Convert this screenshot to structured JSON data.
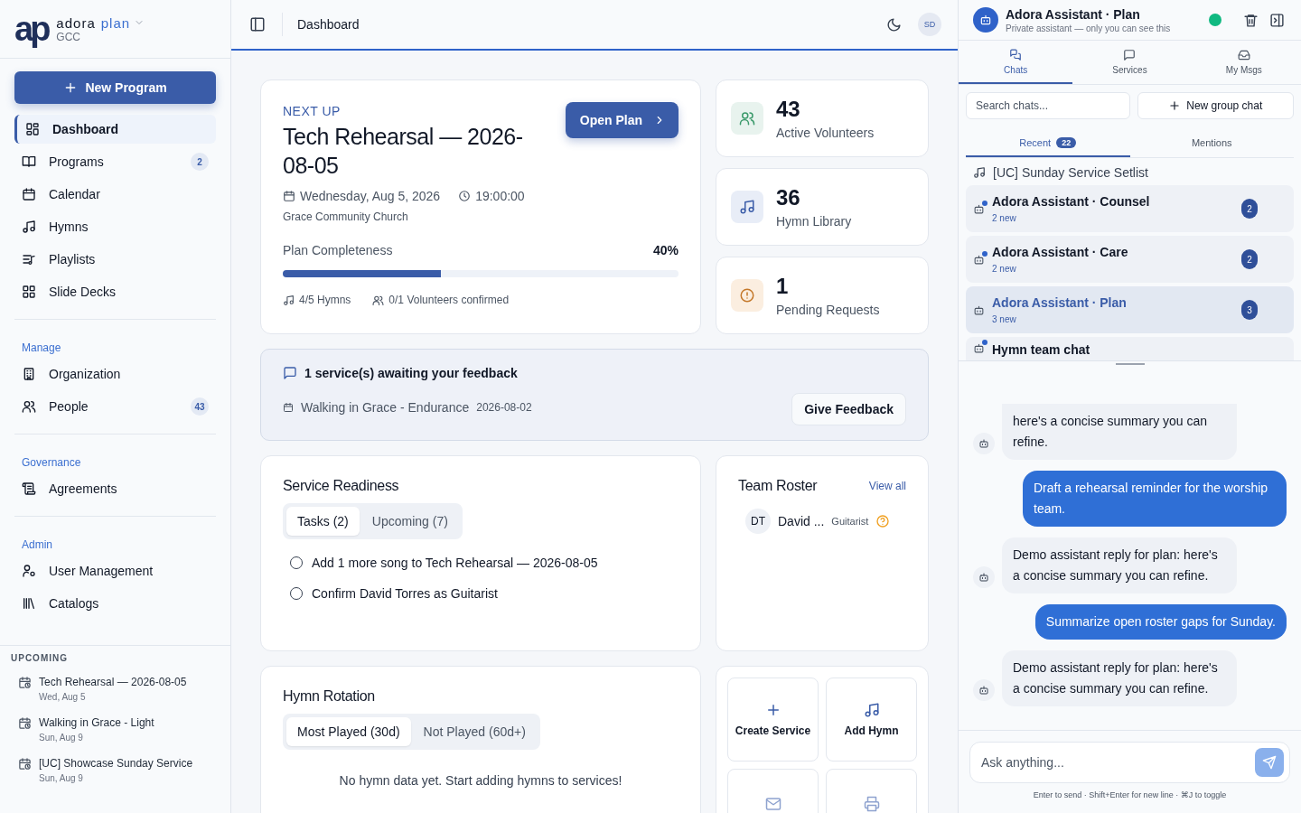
{
  "brand": {
    "logo": "ap",
    "name": "adora",
    "accent": "plan",
    "org": "GCC"
  },
  "new_program_button": "New Program",
  "nav": [
    {
      "kind": "dashboard",
      "label": "Dashboard",
      "selected": true
    },
    {
      "kind": "book",
      "label": "Programs",
      "badge": "2",
      "selected": false
    },
    {
      "kind": "calendar",
      "label": "Calendar",
      "selected": false
    },
    {
      "kind": "music",
      "label": "Hymns",
      "selected": false
    },
    {
      "kind": "playlist",
      "label": "Playlists",
      "selected": false
    },
    {
      "kind": "grid",
      "label": "Slide Decks",
      "selected": false
    }
  ],
  "nav_sections": [
    {
      "title": "Manage",
      "items": [
        {
          "kind": "building",
          "label": "Organization",
          "selected": false
        },
        {
          "kind": "people",
          "label": "People",
          "badge": "43",
          "selected": false
        }
      ]
    },
    {
      "title": "Governance",
      "items": [
        {
          "kind": "scroll",
          "label": "Agreements",
          "selected": false
        }
      ]
    },
    {
      "title": "Admin",
      "items": [
        {
          "kind": "user-gear",
          "label": "User Management",
          "selected": false
        },
        {
          "kind": "library",
          "label": "Catalogs",
          "selected": false
        }
      ]
    }
  ],
  "upcoming": {
    "title": "UPCOMING",
    "items": [
      {
        "title": "Tech Rehearsal — 2026-08-05",
        "date": "Wed, Aug 5"
      },
      {
        "title": "Walking in Grace - Light",
        "date": "Sun, Aug 9"
      },
      {
        "title": "[UC] Showcase Sunday Service",
        "date": "Sun, Aug 9"
      }
    ]
  },
  "topbar": {
    "title": "Dashboard",
    "avatar": "SD"
  },
  "next_up": {
    "eyebrow": "NEXT UP",
    "title": "Tech Rehearsal — 2026-08-05",
    "date": "Wednesday, Aug 5, 2026",
    "time": "19:00:00",
    "location": "Grace Community Church",
    "button": "Open Plan",
    "progress_label": "Plan Completeness",
    "progress_reading": "40%",
    "level": 0.4,
    "hymns": "4/5 Hymns",
    "volunteers": "0/1 Volunteers confirmed"
  },
  "stats": [
    {
      "kind": "volunteers",
      "value": "43",
      "label": "Active Volunteers"
    },
    {
      "kind": "hymns",
      "value": "36",
      "label": "Hymn Library"
    },
    {
      "kind": "requests",
      "value": "1",
      "label": "Pending Requests"
    }
  ],
  "feedback": {
    "title": "1 service(s) awaiting your feedback",
    "service": "Walking in Grace - Endurance",
    "date": "2026-08-02",
    "button": "Give Feedback"
  },
  "readiness": {
    "title": "Service Readiness",
    "tabs": [
      {
        "label": "Tasks (2)",
        "selected": true
      },
      {
        "label": "Upcoming (7)",
        "selected": false
      }
    ],
    "tasks": [
      {
        "text": "Add 1 more song to Tech Rehearsal — 2026-08-05",
        "checked": false
      },
      {
        "text": "Confirm David Torres as Guitarist",
        "checked": false
      }
    ]
  },
  "roster": {
    "title": "Team Roster",
    "link": "View all",
    "members": [
      {
        "initials": "DT",
        "name": "David ...",
        "role": "Guitarist",
        "confirmed": false
      }
    ]
  },
  "hymn_rotation": {
    "title": "Hymn Rotation",
    "tabs": [
      {
        "label": "Most Played (30d)",
        "selected": true
      },
      {
        "label": "Not Played (60d+)",
        "selected": false
      }
    ],
    "empty": "No hymn data yet. Start adding hymns to services!"
  },
  "quick_actions": [
    {
      "kind": "create",
      "label": "Create Service"
    },
    {
      "kind": "hymn",
      "label": "Add Hymn"
    },
    {
      "kind": "mail"
    },
    {
      "kind": "print"
    }
  ],
  "assistant": {
    "title": "Adora Assistant · Plan",
    "subtitle": "Private assistant — only you can see this",
    "online": true,
    "tabs": [
      {
        "kind": "chats",
        "label": "Chats",
        "selected": true
      },
      {
        "kind": "services",
        "label": "Services",
        "selected": false
      },
      {
        "kind": "inbox",
        "label": "My Msgs",
        "selected": false
      }
    ],
    "search_placeholder": "Search chats...",
    "new_group": "New group chat",
    "list_tabs": [
      {
        "label": "Recent",
        "badge": "22",
        "selected": true
      },
      {
        "label": "Mentions",
        "selected": false
      }
    ],
    "group_title": "[UC] Sunday Service Setlist",
    "chats": [
      {
        "title": "Adora Assistant · Counsel",
        "subtitle": "2 new",
        "badge": "2",
        "unread": true,
        "selected": false
      },
      {
        "title": "Adora Assistant · Care",
        "subtitle": "2 new",
        "badge": "2",
        "unread": true,
        "selected": false
      },
      {
        "title": "Adora Assistant · Plan",
        "subtitle": "3 new",
        "badge": "3",
        "unread": false,
        "selected": true
      },
      {
        "title": "Hymn team chat",
        "unread": true,
        "selected": false
      }
    ],
    "messages": [
      {
        "kind": "assistant",
        "text": "here's a concise summary you can refine."
      },
      {
        "kind": "user",
        "text": "Draft a rehearsal reminder for the worship team."
      },
      {
        "kind": "assistant",
        "text": "Demo assistant reply for plan: here's a concise summary you can refine."
      },
      {
        "kind": "user",
        "text": "Summarize open roster gaps for Sunday."
      },
      {
        "kind": "assistant",
        "text": "Demo assistant reply for plan: here's a concise summary you can refine."
      }
    ],
    "input_placeholder": "Ask anything...",
    "hint": "Enter to send · Shift+Enter for new line · ⌘J to toggle"
  }
}
